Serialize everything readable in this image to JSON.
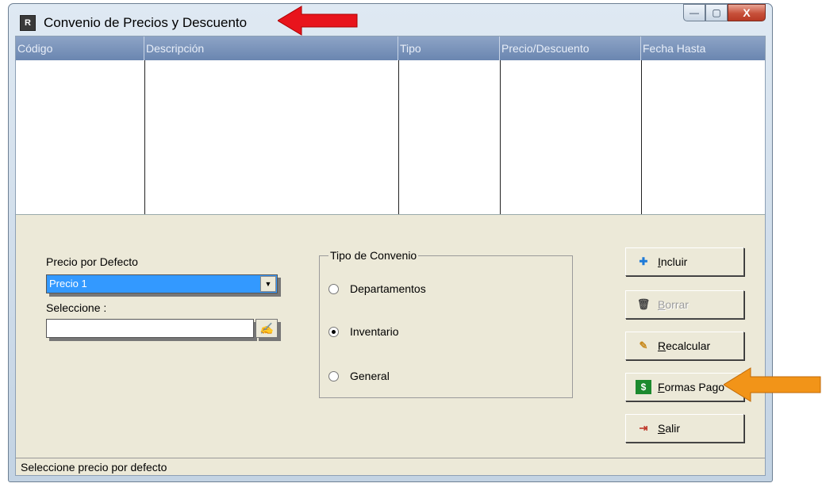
{
  "window": {
    "title": "Convenio de Precios y Descuento",
    "icon": "app-icon",
    "controls": {
      "minimize": "—",
      "maximize": "▢",
      "close": "X"
    }
  },
  "grid": {
    "columns": [
      "Código",
      "Descripción",
      "Tipo",
      "Precio/Descuento",
      "Fecha Hasta"
    ],
    "rows": []
  },
  "form": {
    "precio_label": "Precio por Defecto",
    "precio_value": "Precio 1",
    "seleccione_label": "Seleccione :",
    "seleccione_value": "",
    "browse_glyph": "✍",
    "tipo_group_title": "Tipo de Convenio",
    "tipo_options": [
      {
        "label": "Departamentos",
        "selected": false
      },
      {
        "label": "Inventario",
        "selected": true
      },
      {
        "label": "General",
        "selected": false
      }
    ]
  },
  "buttons": [
    {
      "label": "Incluir",
      "icon": "add-icon",
      "enabled": true
    },
    {
      "label": "Borrar",
      "icon": "trash-icon",
      "enabled": false
    },
    {
      "label": "Recalcular",
      "icon": "pencil-icon",
      "enabled": true
    },
    {
      "label": "Formas Pago",
      "icon": "money-icon",
      "enabled": true
    },
    {
      "label": "Salir",
      "icon": "exit-door-icon",
      "enabled": true
    }
  ],
  "status": {
    "text": "Seleccione precio por defecto"
  },
  "colors": {
    "grid_header": "#7b94bb",
    "combo_selected": "#3399ff",
    "red_arrow": "#e8141c",
    "orange_arrow": "#f29418"
  }
}
